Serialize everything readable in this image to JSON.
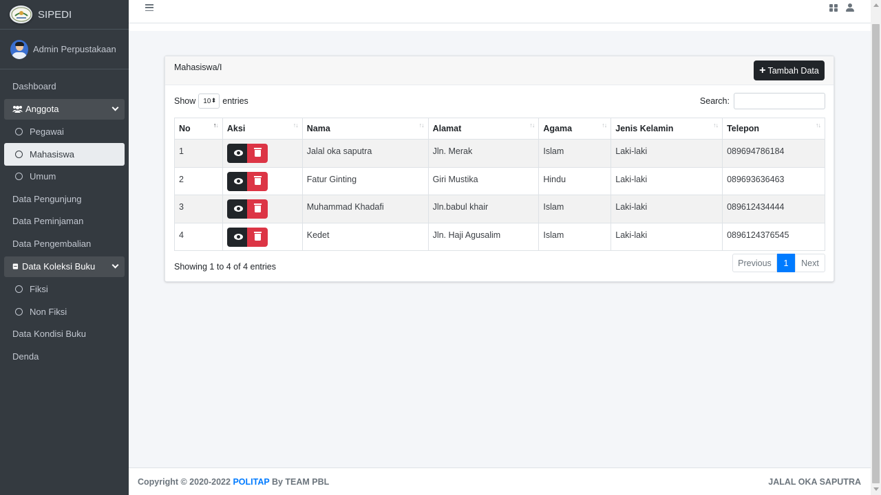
{
  "brand": {
    "name": "SIPEDI"
  },
  "user": {
    "name": "Admin Perpustakaan"
  },
  "sidebar": {
    "items": [
      {
        "label": "Dashboard"
      },
      {
        "label": "Anggota",
        "icon": "users-icon"
      },
      {
        "label": "Pegawai"
      },
      {
        "label": "Mahasiswa",
        "active": true
      },
      {
        "label": "Umum"
      },
      {
        "label": "Data Pengunjung"
      },
      {
        "label": "Data Peminjaman"
      },
      {
        "label": "Data Pengembalian"
      },
      {
        "label": "Data Koleksi Buku",
        "icon": "book-icon"
      },
      {
        "label": "Fiksi"
      },
      {
        "label": "Non Fiksi"
      },
      {
        "label": "Data Kondisi Buku"
      },
      {
        "label": "Denda"
      }
    ]
  },
  "card": {
    "title": "Mahasiswa/I",
    "add_button": "Tambah Data",
    "show_label": "Show",
    "entries_label": "entries",
    "entries_value": "10",
    "search_label": "Search:",
    "search_value": ""
  },
  "table": {
    "headers": [
      "No",
      "Aksi",
      "Nama",
      "Alamat",
      "Agama",
      "Jenis Kelamin",
      "Telepon"
    ],
    "rows": [
      {
        "no": "1",
        "nama": "Jalal oka saputra",
        "alamat": "Jln. Merak",
        "agama": "Islam",
        "jk": "Laki-laki",
        "telepon": "089694786184"
      },
      {
        "no": "2",
        "nama": "Fatur Ginting",
        "alamat": "Giri Mustika",
        "agama": "Hindu",
        "jk": "Laki-laki",
        "telepon": "089693636463"
      },
      {
        "no": "3",
        "nama": "Muhammad Khadafi",
        "alamat": "Jln.babul khair",
        "agama": "Islam",
        "jk": "Laki-laki",
        "telepon": "089612434444"
      },
      {
        "no": "4",
        "nama": "Kedet",
        "alamat": "Jln. Haji Agusalim",
        "agama": "Islam",
        "jk": "Laki-laki",
        "telepon": "0896124376545"
      }
    ]
  },
  "pagination": {
    "info": "Showing 1 to 4 of 4 entries",
    "previous": "Previous",
    "current": "1",
    "next": "Next"
  },
  "footer": {
    "copyright": "Copyright © 2020-2022",
    "org": "POLITAP",
    "by": "By TEAM PBL",
    "author": "JALAL OKA SAPUTRA"
  },
  "colors": {
    "sidebar": "#343a40",
    "accent": "#007bff",
    "danger": "#dc3545",
    "dark": "#212529"
  }
}
